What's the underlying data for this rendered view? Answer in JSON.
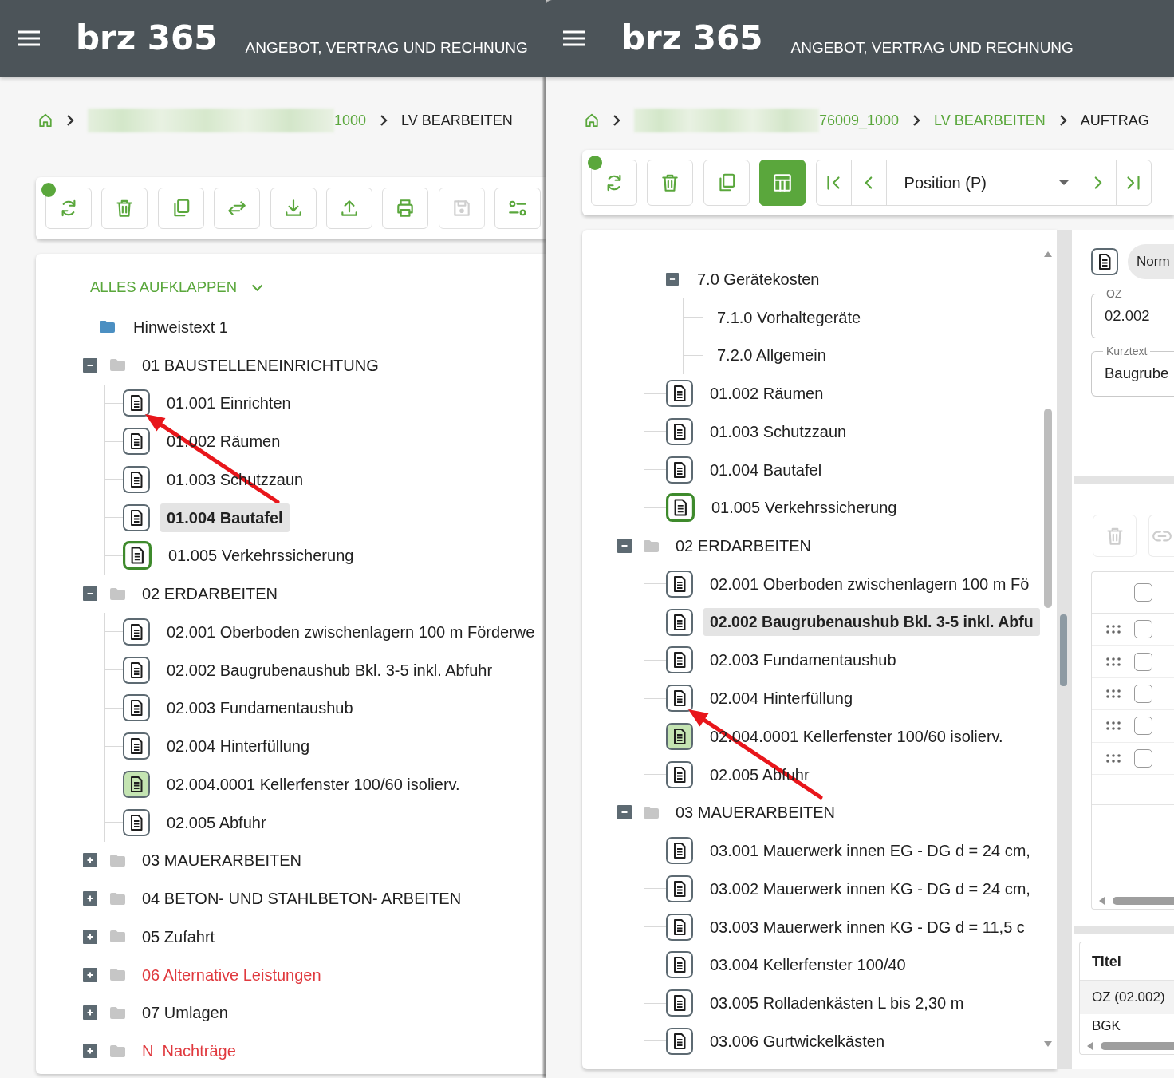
{
  "panels": [
    {
      "header": {
        "logo": "brz 365",
        "title": "ANGEBOT, VERTRAG UND RECHNUNG"
      },
      "breadcrumb": [
        {
          "kind": "home"
        },
        {
          "kind": "link",
          "text": "1000",
          "redacted": true
        },
        {
          "kind": "current",
          "text": "LV BEARBEITEN"
        }
      ],
      "toolbar": {
        "status_dot": true,
        "buttons": [
          {
            "kind": "refresh",
            "disabled": false,
            "active": false
          },
          {
            "kind": "delete",
            "disabled": false,
            "active": false
          },
          {
            "kind": "copy",
            "disabled": false,
            "active": false
          },
          {
            "kind": "swap",
            "disabled": false,
            "active": false
          },
          {
            "kind": "download",
            "disabled": false,
            "active": false
          },
          {
            "kind": "upload",
            "disabled": false,
            "active": false
          },
          {
            "kind": "print",
            "disabled": false,
            "active": false
          },
          {
            "kind": "save",
            "disabled": true,
            "active": false
          },
          {
            "kind": "options",
            "disabled": false,
            "active": false
          }
        ]
      },
      "tree": {
        "expand_all": "ALLES AUFKLAPPEN",
        "items": [
          {
            "kind": "note",
            "label": "Hinweistext 1",
            "selected": false
          },
          {
            "kind": "group",
            "label": "01 BAUSTELLENEINRICHTUNG",
            "color": "#212121",
            "expanded": true,
            "selected": false,
            "children": [
              {
                "kind": "position",
                "label": "01.001 Einrichten",
                "outlined": false,
                "filled": false,
                "selected": false,
                "annotated": true
              },
              {
                "kind": "position",
                "label": "01.002 Räumen",
                "outlined": false,
                "filled": false,
                "selected": false,
                "annotated": false
              },
              {
                "kind": "position",
                "label": "01.003 Schutzzaun",
                "outlined": false,
                "filled": false,
                "selected": false,
                "annotated": false
              },
              {
                "kind": "position",
                "label": "01.004 Bautafel",
                "outlined": false,
                "filled": false,
                "selected": true,
                "annotated": false
              },
              {
                "kind": "position",
                "label": "01.005 Verkehrssicherung",
                "outlined": true,
                "filled": false,
                "selected": false,
                "annotated": false
              }
            ]
          },
          {
            "kind": "group",
            "label": "02 ERDARBEITEN",
            "color": "#212121",
            "expanded": true,
            "selected": false,
            "children": [
              {
                "kind": "position",
                "label": "02.001 Oberboden zwischenlagern 100 m Förderwe",
                "outlined": false,
                "filled": false,
                "selected": false,
                "annotated": false
              },
              {
                "kind": "position",
                "label": "02.002 Baugrubenaushub Bkl. 3-5 inkl. Abfuhr",
                "outlined": false,
                "filled": false,
                "selected": false,
                "annotated": false
              },
              {
                "kind": "position",
                "label": "02.003 Fundamentaushub",
                "outlined": false,
                "filled": false,
                "selected": false,
                "annotated": false
              },
              {
                "kind": "position",
                "label": "02.004 Hinterfüllung",
                "outlined": false,
                "filled": false,
                "selected": false,
                "annotated": false
              },
              {
                "kind": "position",
                "label": "02.004.0001 Kellerfenster 100/60 isolierv.",
                "outlined": false,
                "filled": true,
                "selected": false,
                "annotated": false
              },
              {
                "kind": "position",
                "label": "02.005 Abfuhr",
                "outlined": false,
                "filled": false,
                "selected": false,
                "annotated": false
              }
            ]
          },
          {
            "kind": "group",
            "label": "03 MAUERARBEITEN",
            "color": "#212121",
            "expanded": false,
            "selected": false
          },
          {
            "kind": "group",
            "label": "04 BETON- UND STAHLBETON- ARBEITEN",
            "color": "#212121",
            "expanded": false,
            "selected": false
          },
          {
            "kind": "group",
            "label": "05 Zufahrt",
            "color": "#212121",
            "expanded": false,
            "selected": false
          },
          {
            "kind": "group",
            "label": "06 Alternative Leistungen",
            "color": "#e0393e",
            "expanded": false,
            "selected": false
          },
          {
            "kind": "group",
            "label": "07 Umlagen",
            "color": "#212121",
            "expanded": false,
            "selected": false
          },
          {
            "kind": "group",
            "label": "N  Nachträge",
            "color": "#e0393e",
            "expanded": false,
            "selected": false
          }
        ]
      }
    },
    {
      "header": {
        "logo": "brz 365",
        "title": "ANGEBOT, VERTRAG UND RECHNUNG"
      },
      "breadcrumb": [
        {
          "kind": "home"
        },
        {
          "kind": "link",
          "text": "76009_1000",
          "redacted": true
        },
        {
          "kind": "link",
          "text": "LV BEARBEITEN",
          "redacted": false
        },
        {
          "kind": "current",
          "text": "AUFTRAG"
        }
      ],
      "toolbar": {
        "status_dot": true,
        "buttons": [
          {
            "kind": "refresh",
            "disabled": false,
            "active": false
          },
          {
            "kind": "delete",
            "disabled": false,
            "active": false
          },
          {
            "kind": "copy",
            "disabled": false,
            "active": false
          },
          {
            "kind": "layout",
            "disabled": false,
            "active": true
          },
          {
            "kind": "first",
            "disabled": false,
            "active": false
          },
          {
            "kind": "prev",
            "disabled": false,
            "active": false
          },
          {
            "kind": "select",
            "value": "Position (P)"
          },
          {
            "kind": "next",
            "disabled": false,
            "active": false
          },
          {
            "kind": "last",
            "disabled": false,
            "active": false
          }
        ]
      },
      "tree": {
        "items": [
          {
            "kind": "continued",
            "children": [
              {
                "kind": "subgroup",
                "label": "7.0 Gerätekosten",
                "expanded": true,
                "selected": false,
                "children": [
                  {
                    "kind": "text",
                    "label": "7.1.0 Vorhaltegeräte",
                    "selected": false
                  },
                  {
                    "kind": "text",
                    "label": "7.2.0 Allgemein",
                    "selected": false
                  }
                ]
              },
              {
                "kind": "position",
                "label": "01.002 Räumen",
                "outlined": false,
                "filled": false,
                "selected": false,
                "annotated": false
              },
              {
                "kind": "position",
                "label": "01.003 Schutzzaun",
                "outlined": false,
                "filled": false,
                "selected": false,
                "annotated": false
              },
              {
                "kind": "position",
                "label": "01.004 Bautafel",
                "outlined": false,
                "filled": false,
                "selected": false,
                "annotated": false
              },
              {
                "kind": "position",
                "label": "01.005 Verkehrssicherung",
                "outlined": true,
                "filled": false,
                "selected": false,
                "annotated": false
              }
            ]
          },
          {
            "kind": "group",
            "label": "02 ERDARBEITEN",
            "expanded": true,
            "selected": false,
            "children": [
              {
                "kind": "position",
                "label": "02.001 Oberboden zwischenlagern 100 m Fö",
                "outlined": false,
                "filled": false,
                "selected": false,
                "annotated": false
              },
              {
                "kind": "position",
                "label": "02.002 Baugrubenaushub Bkl. 3-5 inkl. Abfu",
                "outlined": false,
                "filled": false,
                "selected": true,
                "annotated": false
              },
              {
                "kind": "position",
                "label": "02.003 Fundamentaushub",
                "outlined": false,
                "filled": false,
                "selected": false,
                "annotated": false
              },
              {
                "kind": "position",
                "label": "02.004 Hinterfüllung",
                "outlined": false,
                "filled": false,
                "selected": false,
                "annotated": true
              },
              {
                "kind": "position",
                "label": "02.004.0001 Kellerfenster 100/60 isolierv.",
                "outlined": false,
                "filled": true,
                "selected": false,
                "annotated": false
              },
              {
                "kind": "position",
                "label": "02.005 Abfuhr",
                "outlined": false,
                "filled": false,
                "selected": false,
                "annotated": false
              }
            ]
          },
          {
            "kind": "group",
            "label": "03 MAUERARBEITEN",
            "expanded": true,
            "selected": false,
            "children": [
              {
                "kind": "position",
                "label": "03.001 Mauerwerk innen EG - DG d = 24 cm,",
                "outlined": false,
                "filled": false,
                "selected": false,
                "annotated": false
              },
              {
                "kind": "position",
                "label": "03.002 Mauerwerk innen KG - DG d = 24 cm,",
                "outlined": false,
                "filled": false,
                "selected": false,
                "annotated": false
              },
              {
                "kind": "position",
                "label": "03.003 Mauerwerk innen KG - DG d = 11,5 c",
                "outlined": false,
                "filled": false,
                "selected": false,
                "annotated": false
              },
              {
                "kind": "position",
                "label": "03.004 Kellerfenster 100/40",
                "outlined": false,
                "filled": false,
                "selected": false,
                "annotated": false
              },
              {
                "kind": "position",
                "label": "03.005 Rolladenkästen L bis 2,30 m",
                "outlined": false,
                "filled": false,
                "selected": false,
                "annotated": false
              },
              {
                "kind": "position",
                "label": "03.006 Gurtwickelkästen",
                "outlined": false,
                "filled": false,
                "selected": false,
                "annotated": false
              }
            ]
          }
        ]
      },
      "detail": {
        "type_chip": "Norm",
        "fields": [
          {
            "label": "OZ",
            "value": "02.002"
          },
          {
            "label": "Kurztext",
            "value": "Baugrube"
          }
        ],
        "actions": [
          {
            "kind": "delete",
            "disabled": true
          },
          {
            "kind": "link",
            "disabled": true
          }
        ],
        "grid": {
          "header_checked": false,
          "rows": [
            {
              "checked": false
            },
            {
              "checked": false
            },
            {
              "checked": false
            },
            {
              "checked": false
            },
            {
              "checked": false
            }
          ]
        },
        "properties": {
          "columns": [
            "Titel"
          ],
          "rows": [
            {
              "kind": "group",
              "text": "OZ (02.002)"
            },
            {
              "kind": "item",
              "text": "BGK"
            }
          ]
        }
      }
    }
  ]
}
